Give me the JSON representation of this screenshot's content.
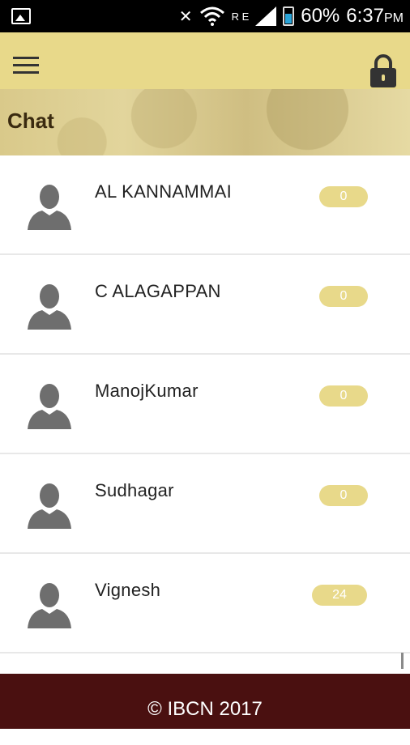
{
  "status_bar": {
    "battery": "60%",
    "time": "6:37",
    "ampm": "PM",
    "network_letters": "R E"
  },
  "app_bar": {
    "menu_icon": "hamburger-menu-icon",
    "lock_icon": "lock-icon"
  },
  "header": {
    "title": "Chat"
  },
  "contacts": [
    {
      "name": "AL KANNAMMAI",
      "count": "0"
    },
    {
      "name": "C ALAGAPPAN",
      "count": "0"
    },
    {
      "name": "ManojKumar",
      "count": "0"
    },
    {
      "name": "Sudhagar",
      "count": "0"
    },
    {
      "name": "Vignesh",
      "count": "24"
    }
  ],
  "footer": {
    "text": "© IBCN 2017"
  },
  "colors": {
    "accent": "#e8d98a",
    "footer": "#4a1010",
    "title": "#3a2a10"
  }
}
